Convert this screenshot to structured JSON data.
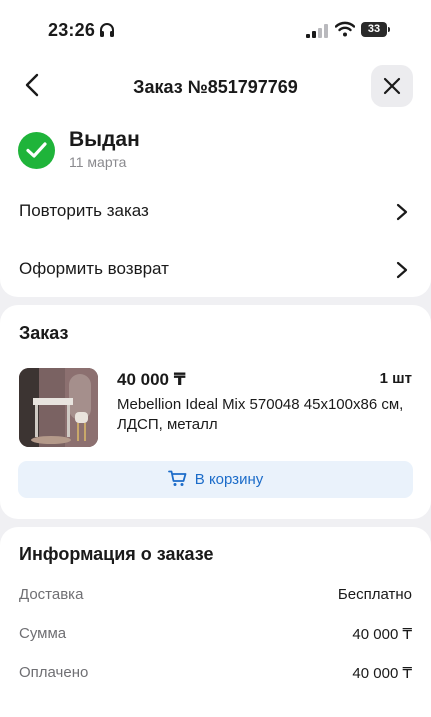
{
  "status_bar": {
    "time": "23:26",
    "battery": "33"
  },
  "header": {
    "title": "Заказ №851797769"
  },
  "order_status": {
    "title": "Выдан",
    "date": "11 марта"
  },
  "actions": [
    {
      "label": "Повторить заказ"
    },
    {
      "label": "Оформить возврат"
    }
  ],
  "order": {
    "section_title": "Заказ",
    "item": {
      "price": "40 000 ₸",
      "quantity": "1 шт",
      "name": "Mebellion Ideal Mix 570048 45x100x86 см, ЛДСП, металл"
    },
    "cart_button": "В корзину"
  },
  "info": {
    "section_title": "Информация о заказе",
    "rows": [
      {
        "label": "Доставка",
        "value": "Бесплатно"
      },
      {
        "label": "Сумма",
        "value": "40 000 ₸"
      },
      {
        "label": "Оплачено",
        "value": "40 000 ₸"
      }
    ]
  },
  "colors": {
    "success": "#1fb43a",
    "accent": "#1c6cc9",
    "accent_bg": "#eaf2fb"
  }
}
